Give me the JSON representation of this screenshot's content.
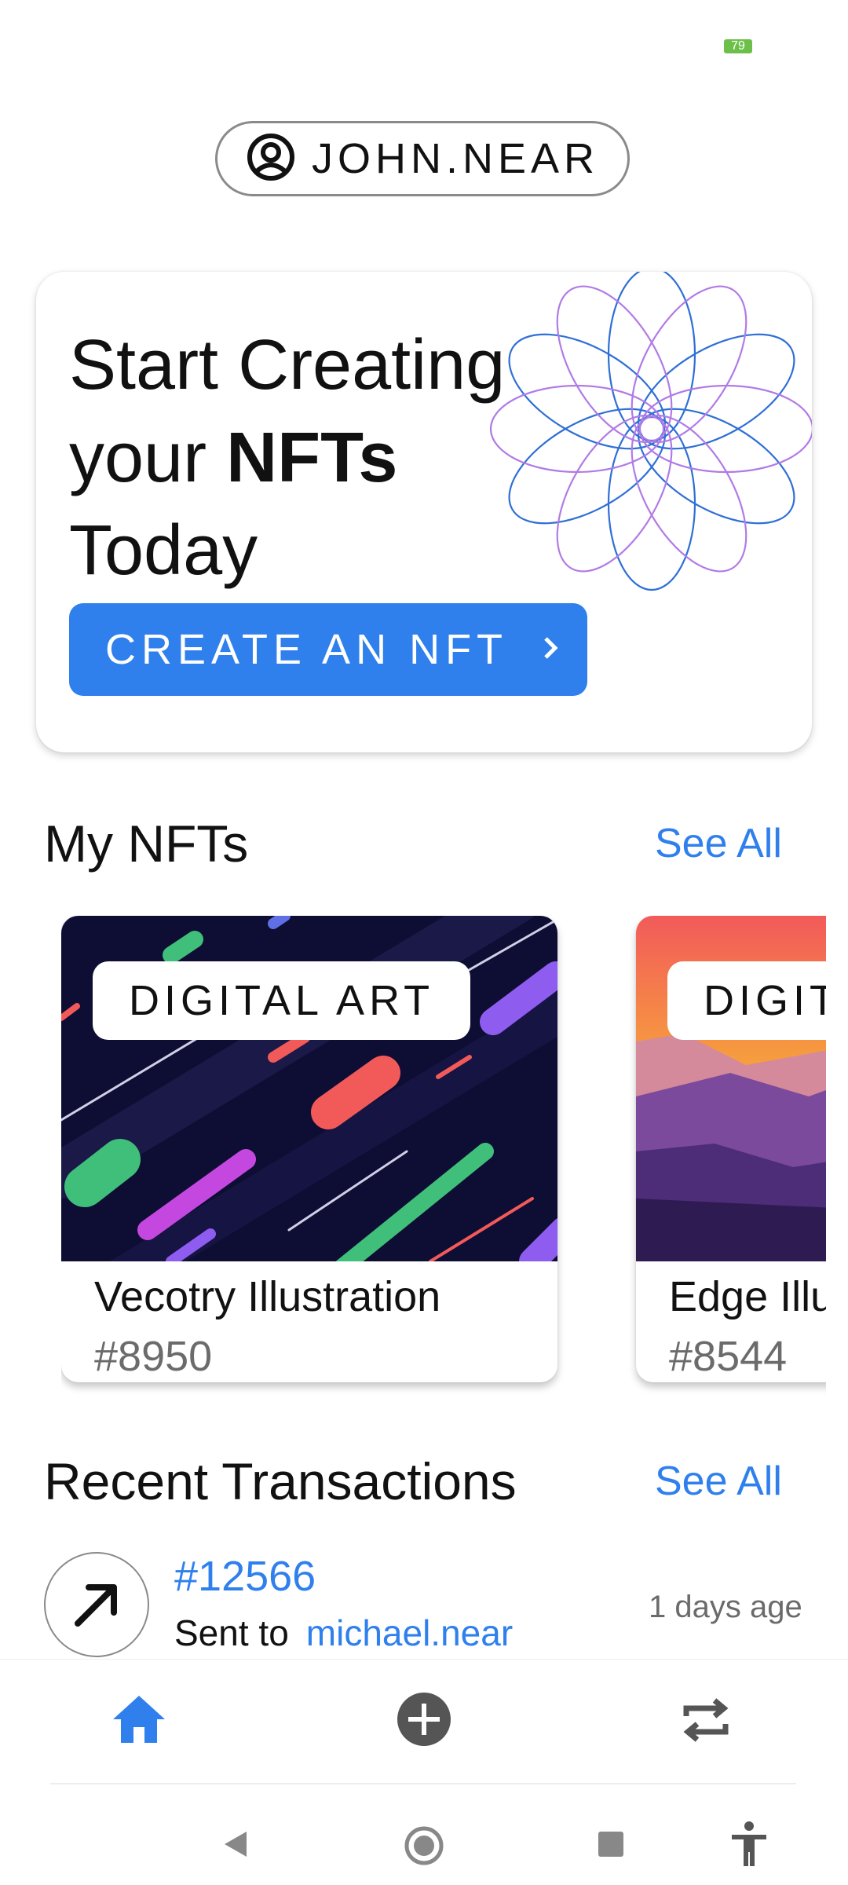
{
  "status_bar": {
    "battery_level": "79",
    "battery_color": "#6cc04a"
  },
  "account": {
    "name": "JOHN.NEAR",
    "icon": "account-circle-icon"
  },
  "hero": {
    "title_line1": "Start Creating",
    "title_line2_prefix": "your",
    "title_line2_bold": "NFTs",
    "title_line3": "Today",
    "button_label": "CREATE AN NFT",
    "button_icon": "chevron-right-icon",
    "accent_color": "#2f80ed"
  },
  "my_nfts": {
    "title": "My NFTs",
    "see_all": "See All",
    "items": [
      {
        "tag": "DIGITAL ART",
        "name": "Vecotry Illustration",
        "id": "#8950"
      },
      {
        "tag": "DIGITAL ART",
        "name": "Edge Illustration",
        "id": "#8544"
      }
    ]
  },
  "recent_transactions": {
    "title": "Recent Transactions",
    "see_all": "See All",
    "items": [
      {
        "id": "#12566",
        "direction_icon": "arrow-up-right-icon",
        "action": "Sent to",
        "recipient": "michael.near",
        "time": "1 days age"
      }
    ]
  },
  "bottom_nav": {
    "items": [
      {
        "icon": "home-icon",
        "active": true
      },
      {
        "icon": "add-circle-icon",
        "active": false
      },
      {
        "icon": "swap-icon",
        "active": false
      }
    ],
    "active_color": "#2f80ed",
    "inactive_color": "#555555"
  },
  "system_nav": [
    "back-icon",
    "home-circle-icon",
    "recents-icon",
    "accessibility-icon"
  ]
}
